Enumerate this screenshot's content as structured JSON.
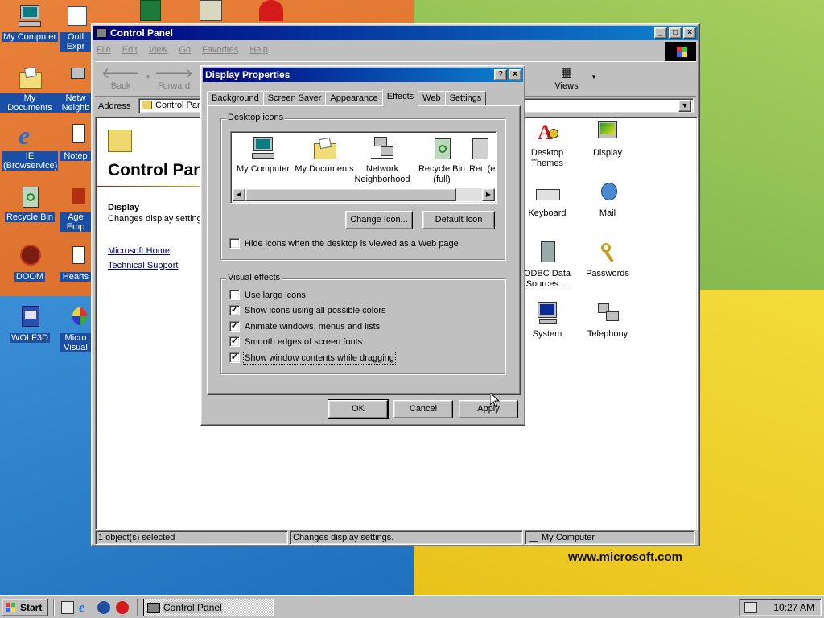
{
  "desktop": {
    "icons_left": [
      {
        "label": "My Computer"
      },
      {
        "label": "My Documents"
      },
      {
        "label": "IE (Browservice)"
      },
      {
        "label": "Recycle Bin"
      },
      {
        "label": "DOOM"
      },
      {
        "label": "WOLF3D"
      }
    ],
    "icons_col2": [
      {
        "label": "Outl Expr"
      },
      {
        "label": "Netw Neighb"
      },
      {
        "label": "Notep"
      },
      {
        "label": "Age Emp"
      },
      {
        "label": "Hearts"
      },
      {
        "label": "Micro Visual"
      }
    ],
    "watermark": "www.microsoft.com"
  },
  "control_panel": {
    "title": "Control Panel",
    "menu": [
      "File",
      "Edit",
      "View",
      "Go",
      "Favorites",
      "Help"
    ],
    "toolbar": {
      "back": "Back",
      "forward": "Forward",
      "views": "Views"
    },
    "address_label": "Address",
    "address_value": "Control Panel",
    "left_pane": {
      "heading": "Control Panel",
      "item_title": "Display",
      "item_desc": "Changes display settings.",
      "links": [
        "Microsoft Home",
        "Technical Support"
      ]
    },
    "icons": [
      {
        "label": "Desktop Themes"
      },
      {
        "label": "Display"
      },
      {
        "label": "Keyboard"
      },
      {
        "label": "Mail"
      },
      {
        "label": "ODBC Data Sources ..."
      },
      {
        "label": "Passwords"
      },
      {
        "label": "System"
      },
      {
        "label": "Telephony"
      }
    ],
    "status": {
      "selected": "1 object(s) selected",
      "desc": "Changes display settings.",
      "zone": "My Computer"
    }
  },
  "dialog": {
    "title": "Display Properties",
    "help_btn": "?",
    "close_btn": "×",
    "tabs": [
      "Background",
      "Screen Saver",
      "Appearance",
      "Effects",
      "Web",
      "Settings"
    ],
    "active_tab": "Effects",
    "desktop_icons_group": "Desktop icons",
    "desktop_icons": [
      {
        "label": "My Computer"
      },
      {
        "label": "My Documents"
      },
      {
        "label": "Network Neighborhood"
      },
      {
        "label": "Recycle Bin (full)"
      },
      {
        "label": "Rec (e"
      }
    ],
    "change_icon_btn": "Change Icon...",
    "default_icon_btn": "Default Icon",
    "hide_icons_label": "Hide icons when the desktop is viewed as a Web page",
    "hide_icons_checked": false,
    "visual_effects_group": "Visual effects",
    "effects": [
      {
        "label": "Use large icons",
        "checked": false
      },
      {
        "label": "Show icons using all possible colors",
        "checked": true
      },
      {
        "label": "Animate windows, menus and lists",
        "checked": true
      },
      {
        "label": "Smooth edges of screen fonts",
        "checked": true
      },
      {
        "label": "Show window contents while dragging",
        "checked": true
      }
    ],
    "ok_btn": "OK",
    "cancel_btn": "Cancel",
    "apply_btn": "Apply"
  },
  "taskbar": {
    "start": "Start",
    "task_button": "Control Panel",
    "clock": "10:27 AM"
  },
  "colors": {
    "title_active": "#00007b",
    "title_gradient_end": "#1084d0",
    "face": "#c0c0c0",
    "link": "#00007b"
  }
}
